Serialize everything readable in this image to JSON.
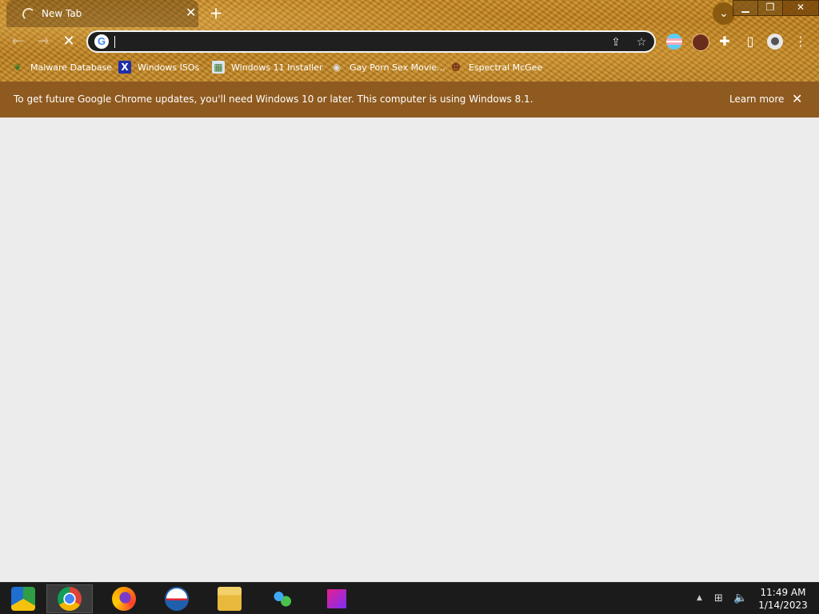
{
  "tab": {
    "title": "New Tab"
  },
  "toolbar": {
    "omnibox_value": "",
    "omnibox_placeholder": ""
  },
  "bookmarks": [
    {
      "label": "Malware Database",
      "icon": "leaf-icon",
      "color": "#3a7a2a"
    },
    {
      "label": "Windows ISOs",
      "icon": "x-logo-icon",
      "color": "#1f2fa8"
    },
    {
      "label": "Windows 11 Installer",
      "icon": "image-icon",
      "color": "#d9e6f2"
    },
    {
      "label": "Gay Porn Sex Movie...",
      "icon": "globe-icon",
      "color": "#cccccc"
    },
    {
      "label": "Espectral McGee",
      "icon": "avatar-icon",
      "color": "#7a3a1a"
    }
  ],
  "infobar": {
    "message": "To get future Google Chrome updates, you'll need Windows 10 or later. This computer is using Windows 8.1.",
    "learn_more": "Learn more"
  },
  "taskbar": {
    "apps": [
      {
        "name": "Chromium"
      },
      {
        "name": "Google Chrome",
        "active": true
      },
      {
        "name": "Firefox"
      },
      {
        "name": "Opera"
      },
      {
        "name": "File Explorer"
      },
      {
        "name": "Network app"
      },
      {
        "name": "Square app"
      }
    ],
    "clock": {
      "time": "11:49 AM",
      "date": "1/14/2023"
    }
  },
  "colors": {
    "frame": "#c48b2a",
    "infobar": "#8f5a1f",
    "content": "#ececec",
    "taskbar": "#1b1b1b"
  }
}
